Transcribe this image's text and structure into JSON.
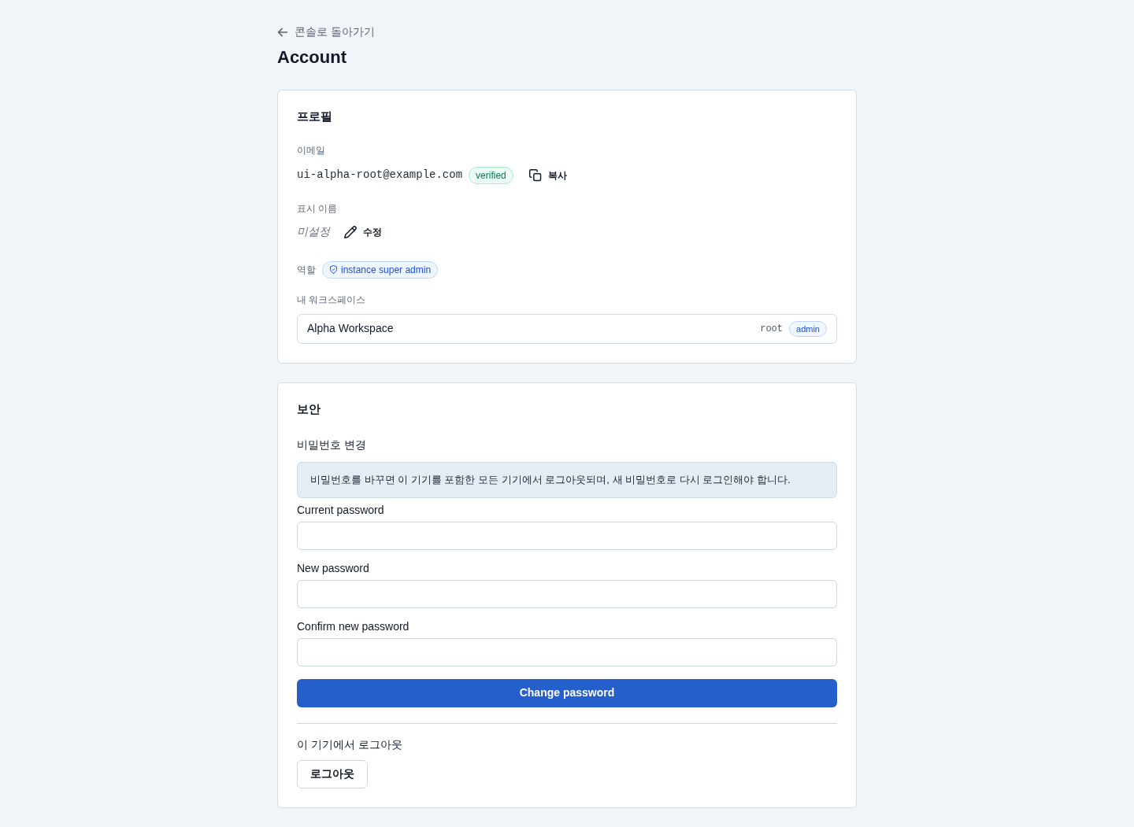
{
  "back_link": {
    "label": "콘솔로 돌아가기"
  },
  "page_title": "Account",
  "profile": {
    "title": "프로필",
    "email": {
      "label": "이메일",
      "value": "ui-alpha-root@example.com",
      "badge": "verified",
      "copy_button": "복사"
    },
    "display_name": {
      "label": "표시 이름",
      "value": "미설정",
      "edit_button": "수정"
    },
    "role": {
      "label": "역할",
      "badge": "instance super admin"
    },
    "workspaces": {
      "label": "내 워크스페이스",
      "items": [
        {
          "name": "Alpha Workspace",
          "slug": "root",
          "role": "admin"
        }
      ]
    }
  },
  "security": {
    "title": "보안",
    "password": {
      "title": "비밀번호 변경",
      "notice": "비밀번호를 바꾸면 이 기기를 포함한 모든 기기에서 로그아웃되며, 새 비밀번호로 다시 로그인해야 합니다.",
      "fields": [
        {
          "label": "Current password"
        },
        {
          "label": "New password"
        },
        {
          "label": "Confirm new password"
        }
      ],
      "submit_button": "Change password"
    },
    "logout": {
      "title": "이 기기에서 로그아웃",
      "button": "로그아웃"
    }
  }
}
